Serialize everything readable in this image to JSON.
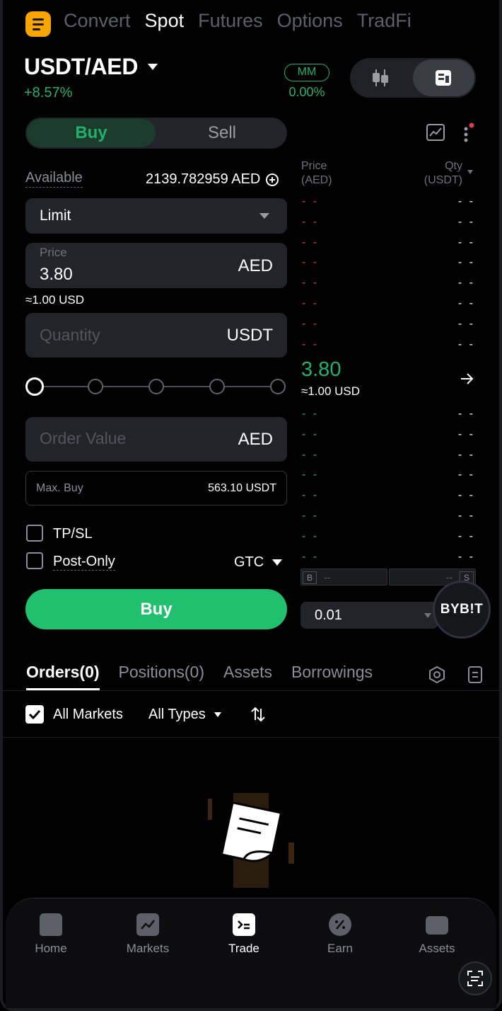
{
  "header": {
    "tabs": [
      "Convert",
      "Spot",
      "Futures",
      "Options",
      "TradFi"
    ],
    "active_tab": "Spot",
    "pair": "USDT/AED",
    "change": "+8.57%",
    "mm_label": "MM",
    "mm_value": "0.00%"
  },
  "form": {
    "buy_label": "Buy",
    "sell_label": "Sell",
    "available_label": "Available",
    "available_value": "2139.782959 AED",
    "order_type": "Limit",
    "price_label": "Price",
    "price_value": "3.80",
    "price_unit": "AED",
    "price_approx": "≈1.00 USD",
    "quantity_placeholder": "Quantity",
    "quantity_unit": "USDT",
    "order_value_placeholder": "Order Value",
    "order_value_unit": "AED",
    "max_buy_label": "Max. Buy",
    "max_buy_value": "563.10 USDT",
    "tpsl_label": "TP/SL",
    "post_only_label": "Post-Only",
    "tif": "GTC",
    "submit_label": "Buy",
    "slider_percent": 0
  },
  "orderbook": {
    "price_header": "Price",
    "price_unit": "(AED)",
    "qty_header": "Qty",
    "qty_unit": "(USDT)",
    "placeholder": "- -",
    "ask_rows": 8,
    "bid_rows": 8,
    "last_price": "3.80",
    "last_price_usd": "≈1.00 USD",
    "ratio_b_label": "B",
    "ratio_b_value": "--",
    "ratio_s_label": "S",
    "ratio_s_value": "--",
    "precision": "0.01",
    "brand": "BYB!T"
  },
  "orders": {
    "tabs": [
      "Orders(0)",
      "Positions(0)",
      "Assets",
      "Borrowings"
    ],
    "all_markets_label": "All Markets",
    "all_markets_checked": true,
    "type_filter": "All Types"
  },
  "nav": {
    "items": [
      "Home",
      "Markets",
      "Trade",
      "Earn",
      "Assets"
    ],
    "active": "Trade"
  },
  "colors": {
    "green": "#20b26c",
    "red": "#e03b4e",
    "brand": "#f7a600",
    "bg": "#000000"
  }
}
